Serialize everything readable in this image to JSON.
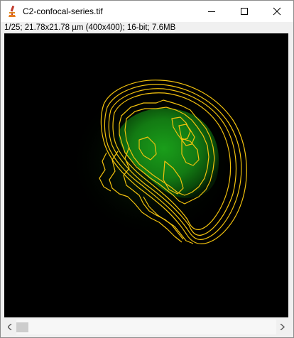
{
  "window": {
    "title": "C2-confocal-series.tif",
    "info": "1/25; 21.78x21.78 µm (400x400); 16-bit; 7.6MB"
  },
  "controls": {
    "minimize_icon": "minimize-icon",
    "maximize_icon": "maximize-icon",
    "close_icon": "close-icon"
  },
  "image": {
    "description_icon": "microscope-icon",
    "background_color": "#000000",
    "signal_color": "#1fae1f",
    "outline_color": "#f2c20e"
  },
  "scrollbar": {
    "position": 0,
    "slices_total": 25,
    "left_icon": "arrow-left-icon",
    "right_icon": "arrow-right-icon"
  }
}
